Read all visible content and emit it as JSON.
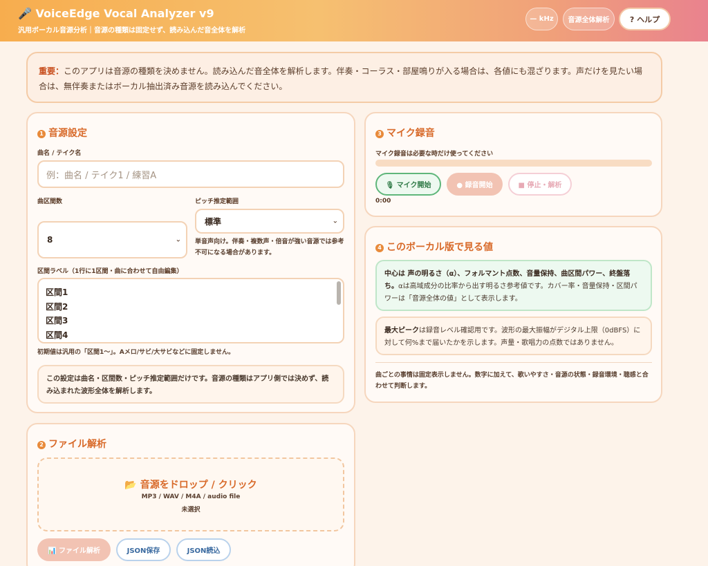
{
  "header": {
    "title": "🎤 VoiceEdge Vocal Analyzer v9",
    "subtitle": "汎用ボーカル音源分析｜音源の種類は固定せず、読み込んだ音全体を解析",
    "khz_badge": "— kHz",
    "whole_badge": "音源全体解析",
    "help_label": "? ヘルプ"
  },
  "notice": {
    "strong": "重要：",
    "text": "このアプリは音源の種類を決めません。読み込んだ音全体を解析します。伴奏・コーラス・部屋鳴りが入る場合は、各値にも混ざります。声だけを見たい場合は、無伴奏またはボーカル抽出済み音源を読み込んでください。"
  },
  "settings": {
    "number": "1",
    "title": "音源設定",
    "song_label": "曲名 / テイク名",
    "song_placeholder": "例：曲名 / テイク1 / 練習A",
    "sections_label": "曲区間数",
    "sections_value": "8",
    "pitch_label": "ピッチ推定範囲",
    "pitch_value": "標準",
    "pitch_help": "単音声向け。伴奏・複数声・倍音が強い音源では参考不可になる場合があります。",
    "labels_label": "区間ラベル（1行に1区間・曲に合わせて自由編集）",
    "labels_lines": [
      "区間1",
      "区間2",
      "区間3",
      "区間4"
    ],
    "labels_help": "初期値は汎用の「区間1〜」。Aメロ/サビ/大サビなどに固定しません。",
    "info": "この設定は曲名・区間数・ピッチ推定範囲だけです。音源の種類はアプリ側では決めず、読み込まれた波形全体を解析します。"
  },
  "file": {
    "number": "2",
    "title": "ファイル解析",
    "drop_title": "📂 音源をドロップ / クリック",
    "drop_formats": "MP3 / WAV / M4A / audio file",
    "drop_status": "未選択",
    "analyze_label": "📊 ファイル解析",
    "save_label": "JSON保存",
    "load_label": "JSON読込"
  },
  "mic": {
    "number": "3",
    "title": "マイク録音",
    "hint": "マイク録音は必要な時だけ使ってください",
    "level": 0.0,
    "start_mic_label": "🎙 マイク開始",
    "record_label": "● 録音開始",
    "stop_label": "■ 停止・解析",
    "timer": "0:00"
  },
  "values": {
    "number": "4",
    "title": "このボーカル版で見る値",
    "green_strong": "中心は 声の明るさ（α）、フォルマント点数、音量保持、曲区間パワー、終盤落ち。",
    "green_text": "αは高域成分の比率から出す明るさ参考値です。カバー率・音量保持・区間パワーは「音源全体の値」として表示します。",
    "peak_strong": "最大ピーク",
    "peak_text": "は録音レベル確認用です。波形の最大振幅がデジタル上限（0dBFS）に対して何%まで届いたかを示します。声量・歌唱力の点数ではありません。",
    "footer": "曲ごとの事情は固定表示しません。数字に加えて、歌いやすさ・音源の状態・録音環境・聴感と合わせて判断します。"
  }
}
